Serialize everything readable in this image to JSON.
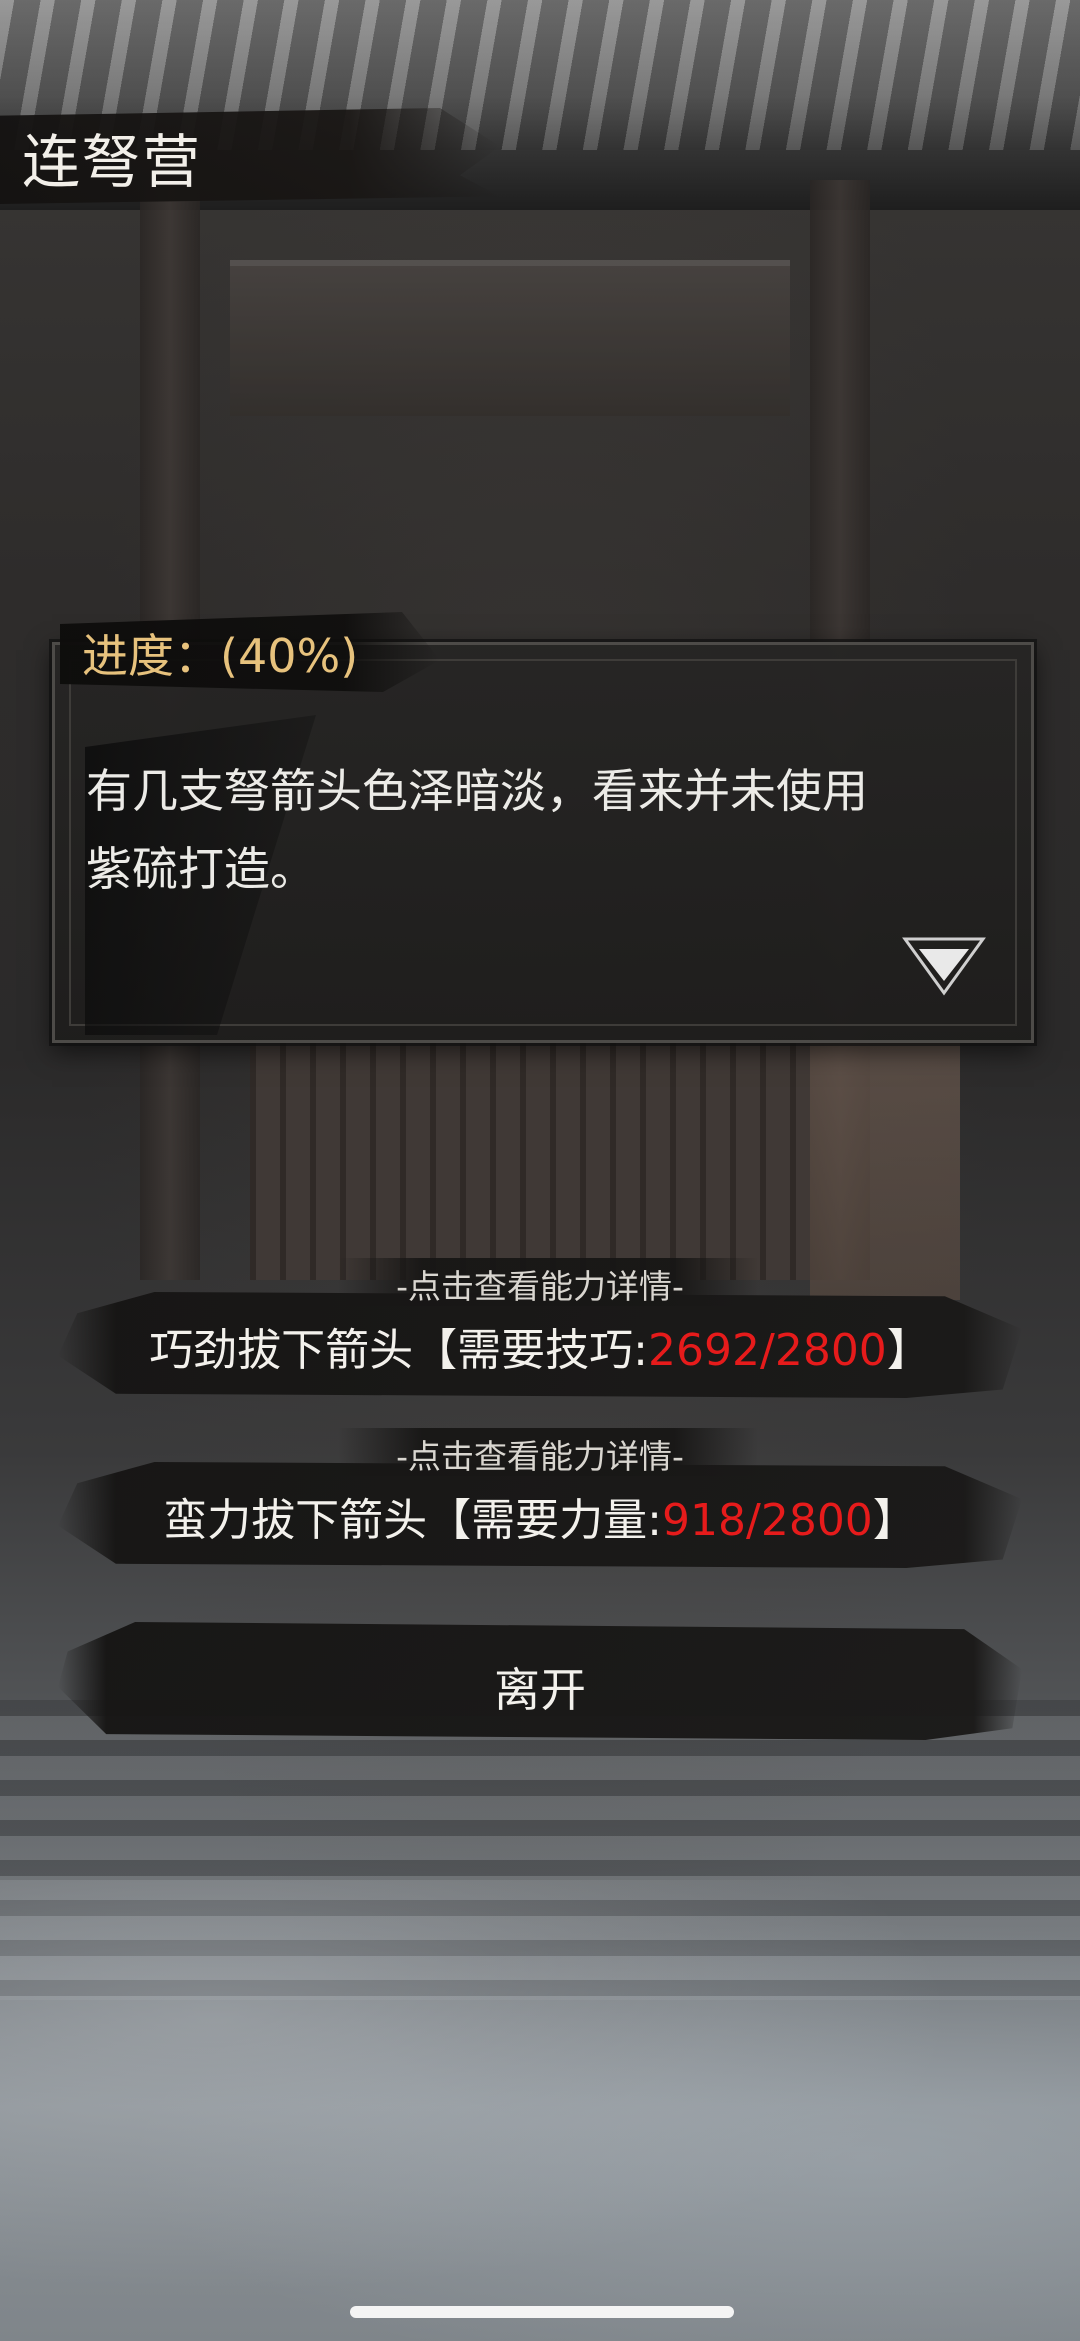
{
  "header": {
    "title": "连弩营"
  },
  "dialog": {
    "progress": "进度：(40%)",
    "line1": "有几支弩箭头色泽暗淡，看来并未使用",
    "line2": "紫硫打造。",
    "next_icon": "down-triangle-icon"
  },
  "options": [
    {
      "hint": "-点击查看能力详情-",
      "label_prefix": "巧劲拔下箭头【需要技巧:",
      "current": "2692",
      "separator": "/",
      "required": "2800",
      "suffix": "】"
    },
    {
      "hint": "-点击查看能力详情-",
      "label_prefix": "蛮力拔下箭头【需要力量:",
      "current": "918",
      "separator": "/",
      "required": "2800",
      "suffix": "】"
    }
  ],
  "leave": {
    "label": "离开"
  },
  "colors": {
    "progress_text": "#e7c27d",
    "insufficient_value": "#e61b1b",
    "text": "#f3f1ec"
  }
}
